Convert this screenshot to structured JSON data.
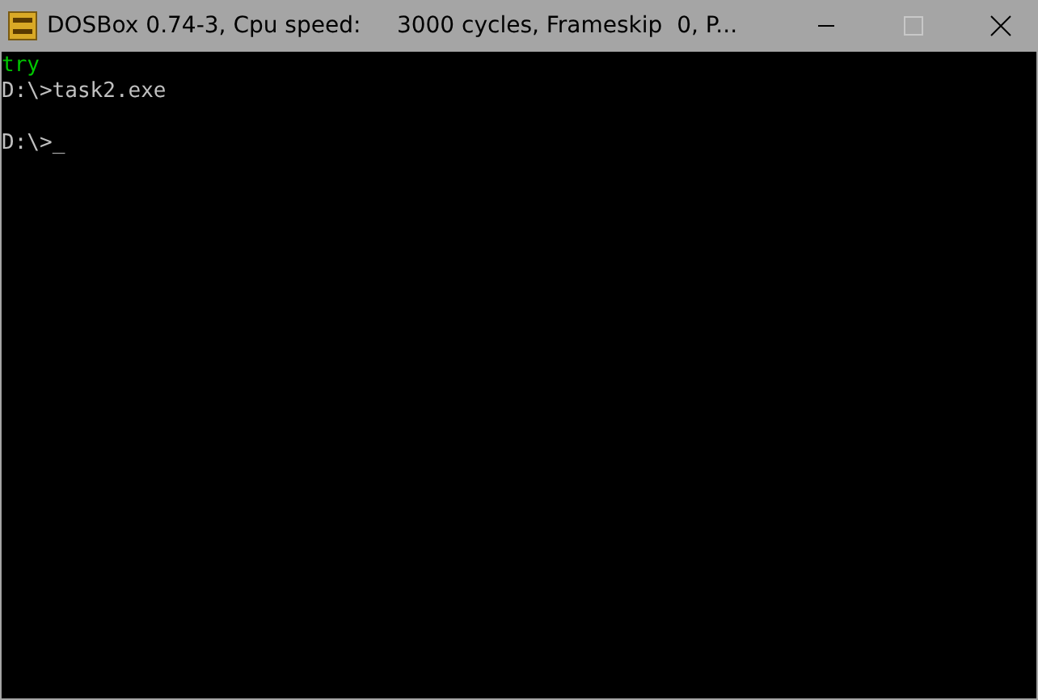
{
  "window": {
    "title": "DOSBox 0.74-3, Cpu speed:     3000 cycles, Frameskip  0, P..."
  },
  "console": {
    "lines": [
      {
        "kind": "text",
        "text": "try",
        "color": "#00c800"
      },
      {
        "kind": "text",
        "text": "D:\\>task2.exe",
        "color": "#c0c0c0"
      },
      {
        "kind": "blank"
      },
      {
        "kind": "text",
        "text": "D:\\>",
        "color": "#c0c0c0",
        "cursor": "_"
      }
    ]
  }
}
